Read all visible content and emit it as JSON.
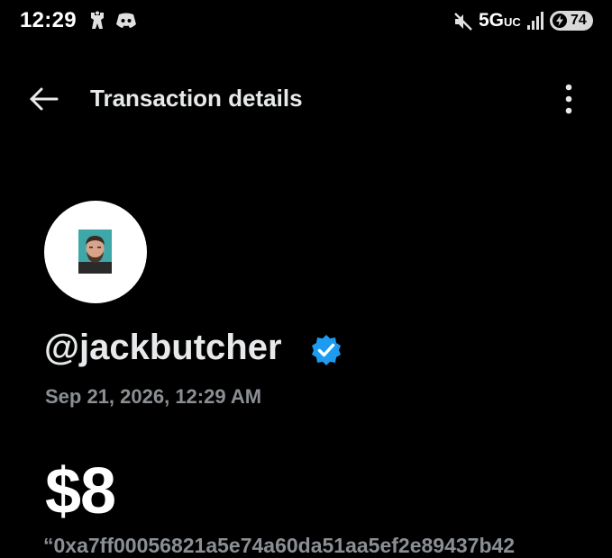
{
  "status_bar": {
    "time": "12:29",
    "network": "5G",
    "network_sub": "UC",
    "battery_level": "74",
    "app_icons": [
      "figure-icon",
      "discord-icon"
    ],
    "system_icons": [
      "mute-icon",
      "signal-icon",
      "charging-bolt-icon"
    ]
  },
  "header": {
    "title": "Transaction details",
    "back_icon": "arrow-left-icon",
    "more_icon": "more-vertical-icon"
  },
  "transaction": {
    "handle": "@jackbutcher",
    "verified": true,
    "timestamp": "Sep 21, 2026, 12:29 AM",
    "amount": "$8",
    "memo": "“0xa7ff00056821a5e74a60da51aa5ef2e89437b42"
  },
  "colors": {
    "background": "#000000",
    "primary_text": "#e7e9ea",
    "secondary_text": "#8b8f93",
    "verified_badge": "#1d9bf0",
    "avatar_bg": "#ffffff"
  }
}
